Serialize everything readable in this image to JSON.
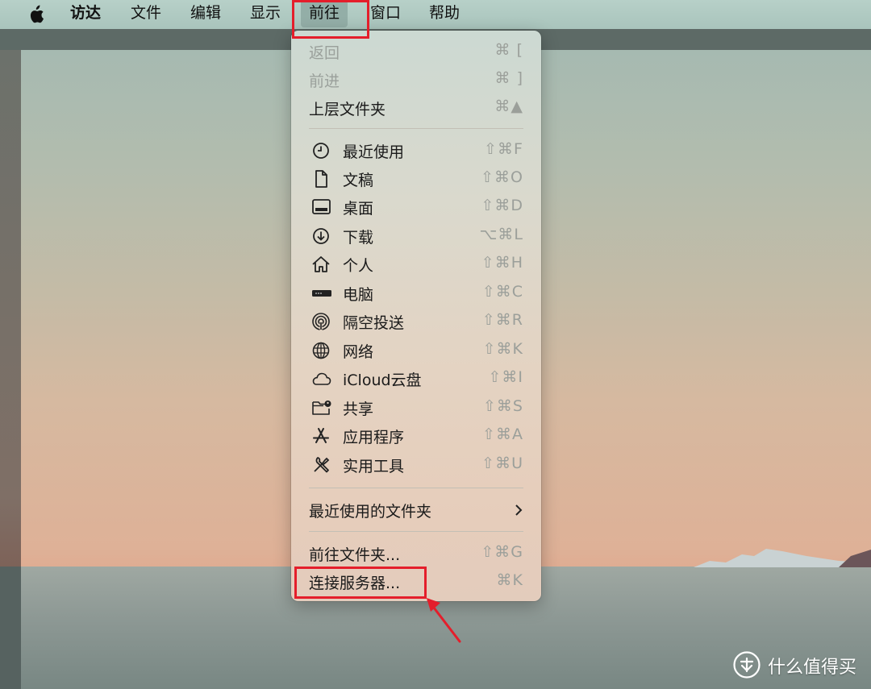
{
  "menubar": {
    "apple": "apple-logo",
    "items": [
      "访达",
      "文件",
      "编辑",
      "显示",
      "前往",
      "窗口",
      "帮助"
    ],
    "active_index": 4
  },
  "go_menu": {
    "nav": [
      {
        "label": "返回",
        "shortcut": "⌘ [",
        "enabled": false
      },
      {
        "label": "前进",
        "shortcut": "⌘ ]",
        "enabled": false
      },
      {
        "label": "上层文件夹",
        "shortcut": "⌘▲",
        "enabled": true
      }
    ],
    "places": [
      {
        "label": "最近使用",
        "shortcut": "⇧⌘F",
        "icon": "clock-icon"
      },
      {
        "label": "文稿",
        "shortcut": "⇧⌘O",
        "icon": "document-icon"
      },
      {
        "label": "桌面",
        "shortcut": "⇧⌘D",
        "icon": "desktop-icon"
      },
      {
        "label": "下载",
        "shortcut": "⌥⌘L",
        "icon": "download-icon"
      },
      {
        "label": "个人",
        "shortcut": "⇧⌘H",
        "icon": "home-icon"
      },
      {
        "label": "电脑",
        "shortcut": "⇧⌘C",
        "icon": "computer-icon"
      },
      {
        "label": "隔空投送",
        "shortcut": "⇧⌘R",
        "icon": "airdrop-icon"
      },
      {
        "label": "网络",
        "shortcut": "⇧⌘K",
        "icon": "network-globe-icon"
      },
      {
        "label": "iCloud云盘",
        "shortcut": "⇧⌘I",
        "icon": "icloud-icon"
      },
      {
        "label": "共享",
        "shortcut": "⇧⌘S",
        "icon": "shared-folder-icon"
      },
      {
        "label": "应用程序",
        "shortcut": "⇧⌘A",
        "icon": "applications-icon"
      },
      {
        "label": "实用工具",
        "shortcut": "⇧⌘U",
        "icon": "utilities-icon"
      }
    ],
    "recent_folders": {
      "label": "最近使用的文件夹"
    },
    "goto": [
      {
        "label": "前往文件夹...",
        "shortcut": "⇧⌘G"
      },
      {
        "label": "连接服务器...",
        "shortcut": "⌘K"
      }
    ]
  },
  "watermark": {
    "text": "什么值得买"
  },
  "colors": {
    "highlight": "#e41e2b"
  }
}
